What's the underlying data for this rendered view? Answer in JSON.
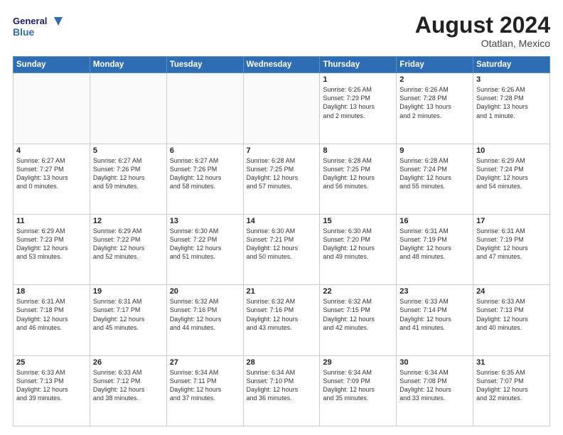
{
  "header": {
    "logo_line1": "General",
    "logo_line2": "Blue",
    "month": "August 2024",
    "location": "Otatlan, Mexico"
  },
  "days_of_week": [
    "Sunday",
    "Monday",
    "Tuesday",
    "Wednesday",
    "Thursday",
    "Friday",
    "Saturday"
  ],
  "weeks": [
    [
      {
        "day": "",
        "info": ""
      },
      {
        "day": "",
        "info": ""
      },
      {
        "day": "",
        "info": ""
      },
      {
        "day": "",
        "info": ""
      },
      {
        "day": "1",
        "info": "Sunrise: 6:26 AM\nSunset: 7:29 PM\nDaylight: 13 hours\nand 2 minutes."
      },
      {
        "day": "2",
        "info": "Sunrise: 6:26 AM\nSunset: 7:28 PM\nDaylight: 13 hours\nand 2 minutes."
      },
      {
        "day": "3",
        "info": "Sunrise: 6:26 AM\nSunset: 7:28 PM\nDaylight: 13 hours\nand 1 minute."
      }
    ],
    [
      {
        "day": "4",
        "info": "Sunrise: 6:27 AM\nSunset: 7:27 PM\nDaylight: 13 hours\nand 0 minutes."
      },
      {
        "day": "5",
        "info": "Sunrise: 6:27 AM\nSunset: 7:26 PM\nDaylight: 12 hours\nand 59 minutes."
      },
      {
        "day": "6",
        "info": "Sunrise: 6:27 AM\nSunset: 7:26 PM\nDaylight: 12 hours\nand 58 minutes."
      },
      {
        "day": "7",
        "info": "Sunrise: 6:28 AM\nSunset: 7:25 PM\nDaylight: 12 hours\nand 57 minutes."
      },
      {
        "day": "8",
        "info": "Sunrise: 6:28 AM\nSunset: 7:25 PM\nDaylight: 12 hours\nand 56 minutes."
      },
      {
        "day": "9",
        "info": "Sunrise: 6:28 AM\nSunset: 7:24 PM\nDaylight: 12 hours\nand 55 minutes."
      },
      {
        "day": "10",
        "info": "Sunrise: 6:29 AM\nSunset: 7:24 PM\nDaylight: 12 hours\nand 54 minutes."
      }
    ],
    [
      {
        "day": "11",
        "info": "Sunrise: 6:29 AM\nSunset: 7:23 PM\nDaylight: 12 hours\nand 53 minutes."
      },
      {
        "day": "12",
        "info": "Sunrise: 6:29 AM\nSunset: 7:22 PM\nDaylight: 12 hours\nand 52 minutes."
      },
      {
        "day": "13",
        "info": "Sunrise: 6:30 AM\nSunset: 7:22 PM\nDaylight: 12 hours\nand 51 minutes."
      },
      {
        "day": "14",
        "info": "Sunrise: 6:30 AM\nSunset: 7:21 PM\nDaylight: 12 hours\nand 50 minutes."
      },
      {
        "day": "15",
        "info": "Sunrise: 6:30 AM\nSunset: 7:20 PM\nDaylight: 12 hours\nand 49 minutes."
      },
      {
        "day": "16",
        "info": "Sunrise: 6:31 AM\nSunset: 7:19 PM\nDaylight: 12 hours\nand 48 minutes."
      },
      {
        "day": "17",
        "info": "Sunrise: 6:31 AM\nSunset: 7:19 PM\nDaylight: 12 hours\nand 47 minutes."
      }
    ],
    [
      {
        "day": "18",
        "info": "Sunrise: 6:31 AM\nSunset: 7:18 PM\nDaylight: 12 hours\nand 46 minutes."
      },
      {
        "day": "19",
        "info": "Sunrise: 6:31 AM\nSunset: 7:17 PM\nDaylight: 12 hours\nand 45 minutes."
      },
      {
        "day": "20",
        "info": "Sunrise: 6:32 AM\nSunset: 7:16 PM\nDaylight: 12 hours\nand 44 minutes."
      },
      {
        "day": "21",
        "info": "Sunrise: 6:32 AM\nSunset: 7:16 PM\nDaylight: 12 hours\nand 43 minutes."
      },
      {
        "day": "22",
        "info": "Sunrise: 6:32 AM\nSunset: 7:15 PM\nDaylight: 12 hours\nand 42 minutes."
      },
      {
        "day": "23",
        "info": "Sunrise: 6:33 AM\nSunset: 7:14 PM\nDaylight: 12 hours\nand 41 minutes."
      },
      {
        "day": "24",
        "info": "Sunrise: 6:33 AM\nSunset: 7:13 PM\nDaylight: 12 hours\nand 40 minutes."
      }
    ],
    [
      {
        "day": "25",
        "info": "Sunrise: 6:33 AM\nSunset: 7:13 PM\nDaylight: 12 hours\nand 39 minutes."
      },
      {
        "day": "26",
        "info": "Sunrise: 6:33 AM\nSunset: 7:12 PM\nDaylight: 12 hours\nand 38 minutes."
      },
      {
        "day": "27",
        "info": "Sunrise: 6:34 AM\nSunset: 7:11 PM\nDaylight: 12 hours\nand 37 minutes."
      },
      {
        "day": "28",
        "info": "Sunrise: 6:34 AM\nSunset: 7:10 PM\nDaylight: 12 hours\nand 36 minutes."
      },
      {
        "day": "29",
        "info": "Sunrise: 6:34 AM\nSunset: 7:09 PM\nDaylight: 12 hours\nand 35 minutes."
      },
      {
        "day": "30",
        "info": "Sunrise: 6:34 AM\nSunset: 7:08 PM\nDaylight: 12 hours\nand 33 minutes."
      },
      {
        "day": "31",
        "info": "Sunrise: 6:35 AM\nSunset: 7:07 PM\nDaylight: 12 hours\nand 32 minutes."
      }
    ]
  ]
}
